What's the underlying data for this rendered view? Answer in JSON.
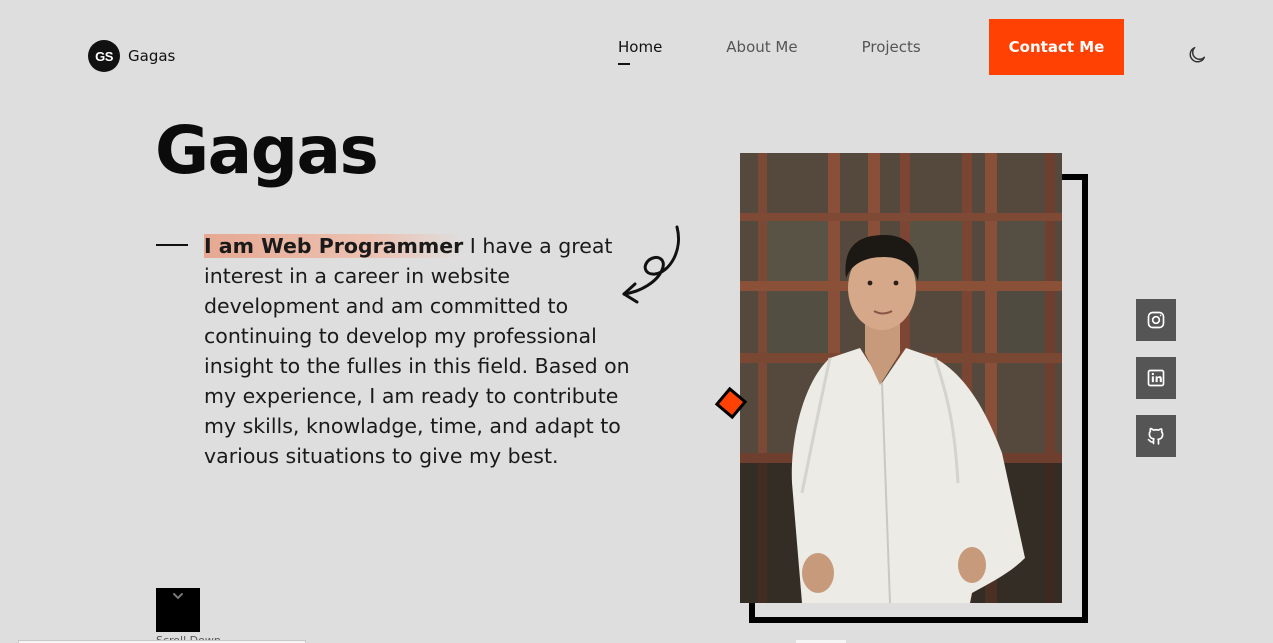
{
  "brand": {
    "initials": "GS",
    "name": "Gagas"
  },
  "nav": {
    "items": [
      {
        "label": "Home",
        "active": true
      },
      {
        "label": "About Me",
        "active": false
      },
      {
        "label": "Projects",
        "active": false
      }
    ],
    "cta": "Contact Me",
    "theme_toggle_icon": "moon-icon"
  },
  "hero": {
    "title": "Gagas",
    "highlight": "I am Web Programmer",
    "description": " I have a great interest in a career in website development and am committed to continuing to develop my professional insight to the fulles in this field. Based on my experience, I am ready to contribute my skills, knowladge, time, and adapt to various situations to give my best."
  },
  "social": [
    {
      "icon": "instagram-icon"
    },
    {
      "icon": "linkedin-icon"
    },
    {
      "icon": "github-icon"
    }
  ],
  "scroll": {
    "label": "Scroll Down",
    "icon": "chevron-down-icon"
  },
  "colors": {
    "accent": "#ff4104",
    "background": "#dedede",
    "text": "#111111",
    "social_bg": "#555555"
  }
}
